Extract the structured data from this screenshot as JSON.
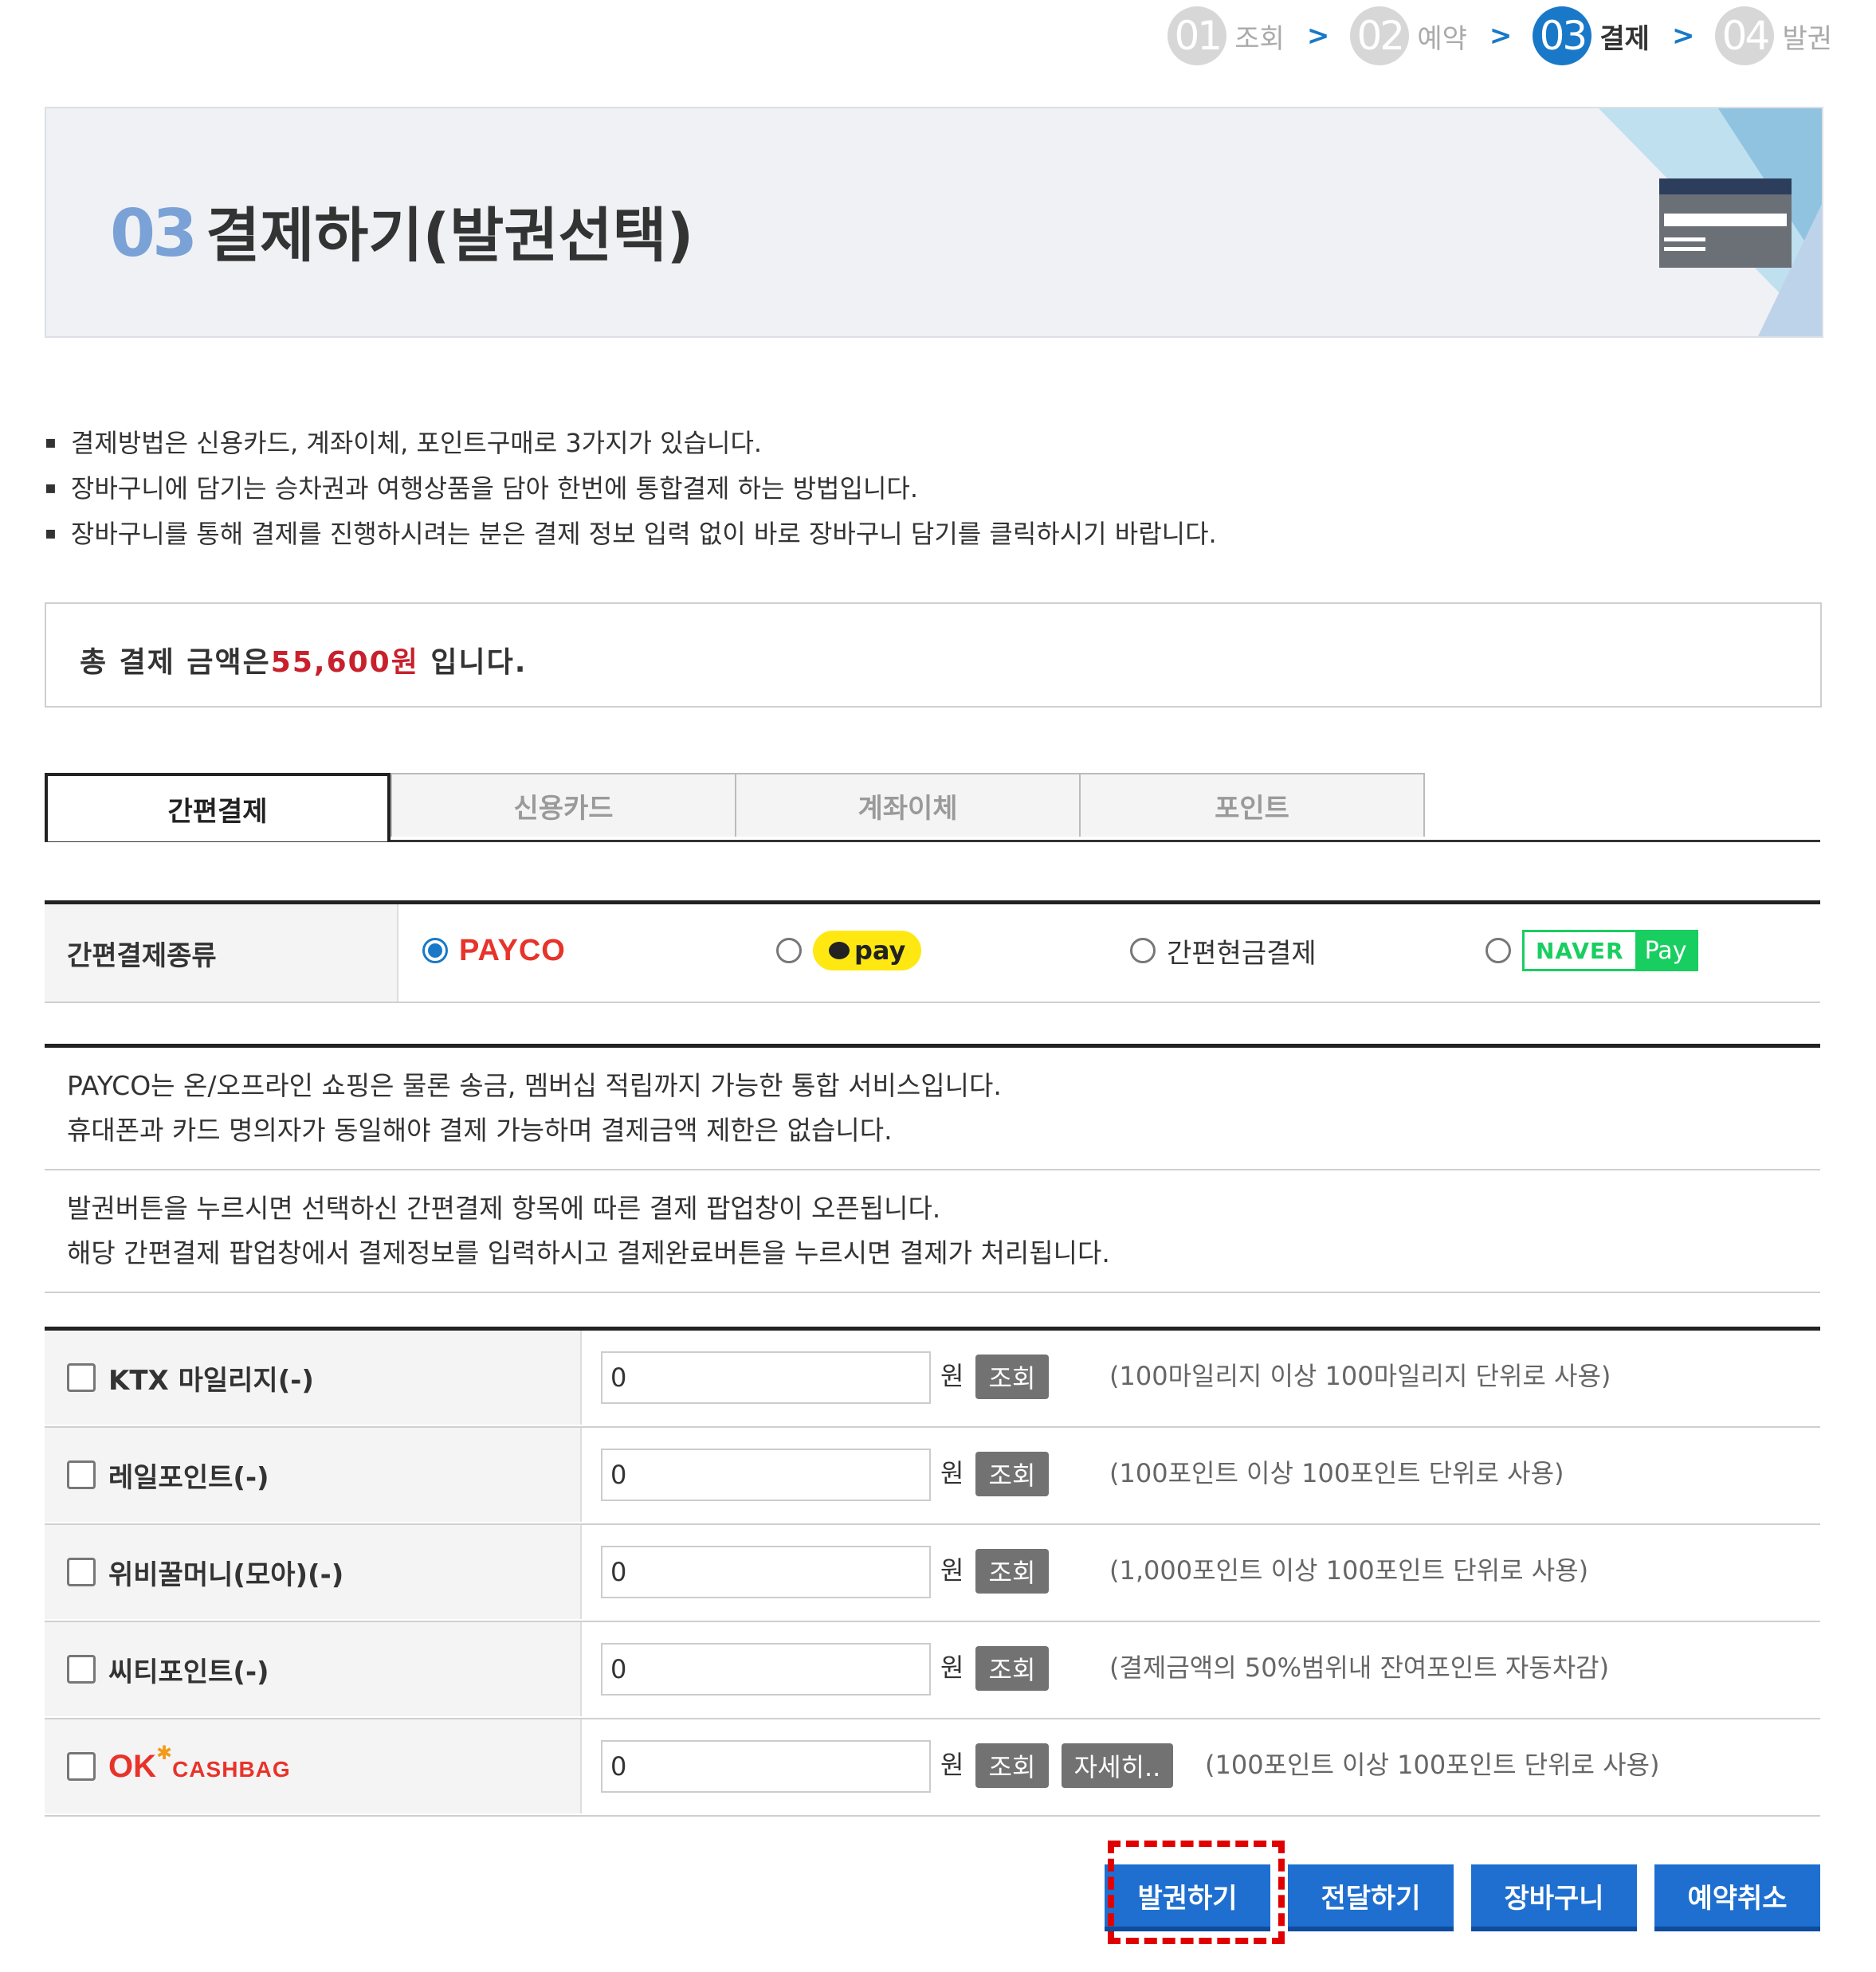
{
  "steps": [
    {
      "num": "01",
      "label": "조회"
    },
    {
      "num": "02",
      "label": "예약"
    },
    {
      "num": "03",
      "label": "결제"
    },
    {
      "num": "04",
      "label": "발권"
    }
  ],
  "banner": {
    "num": "03",
    "title": "결제하기(발권선택)"
  },
  "notices": [
    "결제방법은 신용카드, 계좌이체, 포인트구매로 3가지가 있습니다.",
    "장바구니에 담기는 승차권과 여행상품을 담아 한번에 통합결제 하는 방법입니다.",
    "장바구니를 통해 결제를 진행하시려는 분은 결제 정보 입력 없이 바로 장바구니 담기를 클릭하시기 바랍니다."
  ],
  "total": {
    "prefix": "총 결제 금액은",
    "amount": "55,600원",
    "suffix": " 입니다."
  },
  "tabs": [
    "간편결제",
    "신용카드",
    "계좌이체",
    "포인트"
  ],
  "paytype": {
    "label": "간편결제종류",
    "payco": "PAYCO",
    "kakao": "pay",
    "cash": "간편현금결제",
    "naver_a": "NAVER",
    "naver_b": "Pay"
  },
  "info": [
    [
      "PAYCO는 온/오프라인 쇼핑은 물론 송금, 멤버십 적립까지 가능한 통합 서비스입니다.",
      "휴대폰과 카드 명의자가 동일해야 결제 가능하며 결제금액 제한은 없습니다."
    ],
    [
      "발권버튼을 누르시면 선택하신 간편결제 항목에 따른 결제 팝업창이 오픈됩니다.",
      "해당 간편결제 팝업창에서 결제정보를 입력하시고 결제완료버튼을 누르시면 결제가 처리됩니다."
    ]
  ],
  "points": [
    {
      "label": "KTX 마일리지(-)",
      "value": "0",
      "unit": "원",
      "btn": "조회",
      "note": "(100마일리지 이상 100마일리지 단위로 사용)"
    },
    {
      "label": "레일포인트(-)",
      "value": "0",
      "unit": "원",
      "btn": "조회",
      "note": "(100포인트 이상 100포인트 단위로 사용)"
    },
    {
      "label": "위비꿀머니(모아)(-)",
      "value": "0",
      "unit": "원",
      "btn": "조회",
      "note": "(1,000포인트 이상 100포인트 단위로 사용)"
    },
    {
      "label": "씨티포인트(-)",
      "value": "0",
      "unit": "원",
      "btn": "조회",
      "note": "(결제금액의 50%범위내 잔여포인트 자동차감)"
    },
    {
      "logo_ok": "OK",
      "logo_cb": "CASHBAG",
      "value": "0",
      "unit": "원",
      "btn": "조회",
      "btn2": "자세히..",
      "note": "(100포인트 이상 100포인트 단위로 사용)"
    }
  ],
  "actions": [
    "발권하기",
    "전달하기",
    "장바구니",
    "예약취소"
  ]
}
